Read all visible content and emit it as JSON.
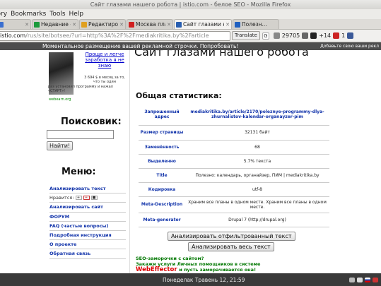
{
  "window": {
    "title": "Сайт глазами нашего робота | istio.com - белое SEO - Mozilla Firefox"
  },
  "menubar": [
    "tory",
    "Bookmarks",
    "Tools",
    "Help"
  ],
  "tabs": [
    {
      "label": "",
      "favicon_color": "#3a6fd0"
    },
    {
      "label": "Недавние – Диск ...",
      "favicon_color": "#1b9a3b"
    },
    {
      "label": "Редактирование т...",
      "favicon_color": "#e0a020"
    },
    {
      "label": "Москва платит, М...",
      "favicon_color": "#d02020"
    },
    {
      "label": "Сайт глазами наш...",
      "favicon_color": "#2a5fb0",
      "active": true
    },
    {
      "label": "Полезн...",
      "favicon_color": "#2060c0"
    }
  ],
  "navbar": {
    "url_host": "istio.com",
    "url_path": "/rus/site/botsee/?url=http%3A%2F%2Fmediakritika.by%2Farticle",
    "translate_label": "Translate",
    "counter1": "29705",
    "counter2": "+14",
    "counter3": "1"
  },
  "adstrip": {
    "text": "Моментальное размещение вашей рекламной строчки. Попробовать!",
    "right": "Добавьте свою ваши рекл"
  },
  "sidebar": {
    "ad_link": "Проще и легче заработка я не знаю",
    "ad_small": "3 694 $ в месяц за то, что ты один",
    "ad_small2": "раз установил программу и нажал «СТАРТ»!",
    "ad_url": "webearn.org",
    "search_title": "Поисковик:",
    "search_button": "Найти!",
    "menu_title": "Меню:",
    "menu_items": [
      "Анализировать текст",
      "Нравится:",
      "Анализировать сайт",
      "ФОРУМ",
      "FAQ (частые вопросы)",
      "Подробная инструкция",
      "О проекте",
      "Обратная связь"
    ]
  },
  "main": {
    "title": "Сайт глазами нашего робота",
    "section_title": "Общая статистика:",
    "stats": [
      {
        "key": "Запрошенный адрес",
        "value": "mediakritika.by/article/2170/poleznye-programmy-dlya-zhurnalistov-kalendar-organayzer-pim",
        "link": true
      },
      {
        "key": "Размер страницы",
        "value": "32131 байт"
      },
      {
        "key": "Заменённость",
        "value": "68"
      },
      {
        "key": "Выделенно",
        "value": "5.7% текста"
      },
      {
        "key": "Title",
        "value": "Полезно: календарь, органайзер, ПИМ | mediakritika.by"
      },
      {
        "key": "Кодировка",
        "value": "utf-8"
      },
      {
        "key": "Meta-Description",
        "value": "Храним все планы в одном месте. Храним все планы в одном месте."
      },
      {
        "key": "Meta-generator",
        "value": "Drupal 7 (http://drupal.org)"
      }
    ],
    "btn_filtered": "Анализировать отфильтрованный текст",
    "btn_all": "Анализировать весь текст",
    "promo1": "SEO-заморочки с сайтом?",
    "promo2": "Закажи услуги Личных помощников в системе",
    "promo_brand": "WebEffector",
    "promo_rest": "и пусть заморачивается она!"
  },
  "panel": {
    "clock": "Понеделак Травень 12, 21:59"
  }
}
